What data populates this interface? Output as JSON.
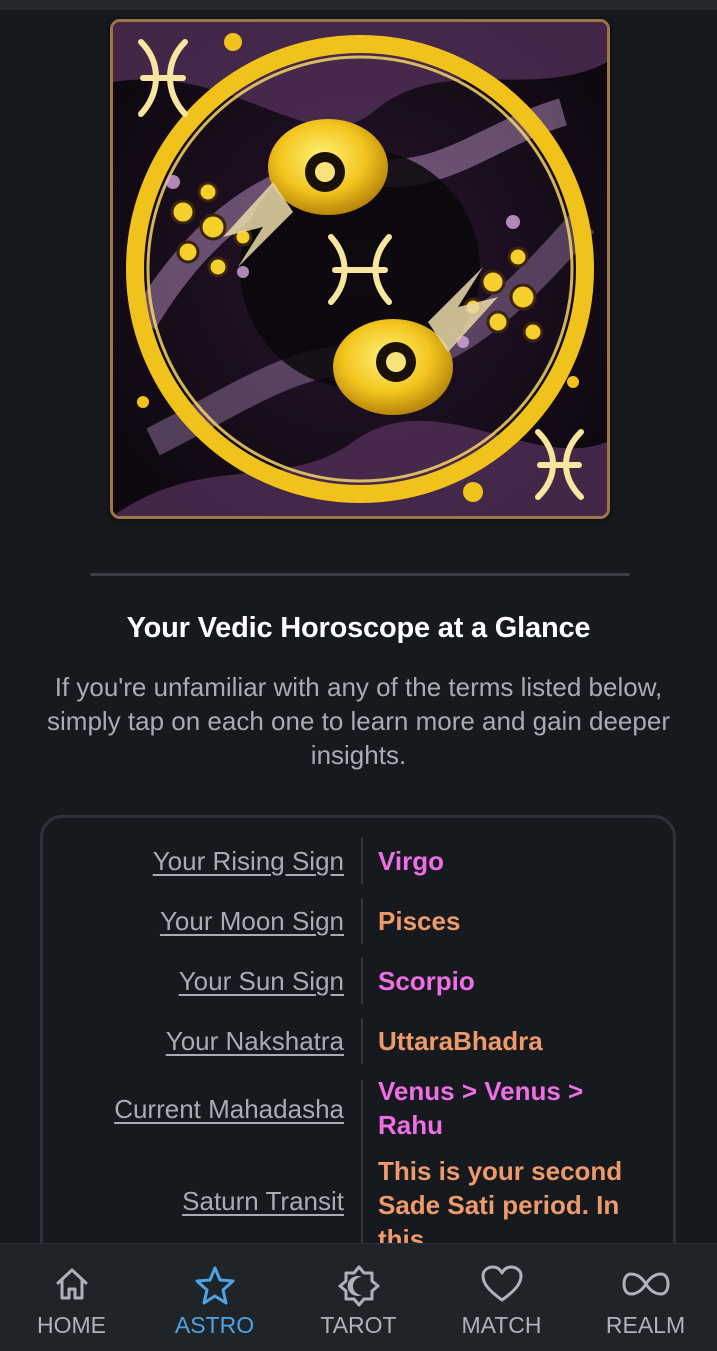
{
  "hero": {
    "image": "pisces-zodiac-artwork",
    "frame_color": "#a0754a"
  },
  "section": {
    "title": "Your Vedic Horoscope at a Glance",
    "subtitle": "If you're unfamiliar with any of the terms listed below, simply tap on each one to learn more and gain deeper insights."
  },
  "horoscope": {
    "rows": [
      {
        "label": "Your Rising Sign",
        "value": "Virgo",
        "color": "#f06ee6"
      },
      {
        "label": "Your Moon Sign",
        "value": "Pisces",
        "color": "#ef9a6a"
      },
      {
        "label": "Your Sun Sign",
        "value": "Scorpio",
        "color": "#f06ee6"
      },
      {
        "label": "Your Nakshatra",
        "value": "UttaraBhadra",
        "color": "#ef9a6a"
      },
      {
        "label": "Current Mahadasha",
        "value": "Venus > Venus > Rahu",
        "color": "#f06ee6"
      },
      {
        "label": "Saturn Transit",
        "value": "This is your second Sade Sati period. In this...",
        "color": "#ef9a6a"
      }
    ]
  },
  "nav": {
    "items": [
      {
        "label": "HOME",
        "icon": "home-icon",
        "active": false
      },
      {
        "label": "ASTRO",
        "icon": "star-icon",
        "active": true
      },
      {
        "label": "TAROT",
        "icon": "sun-moon-icon",
        "active": false
      },
      {
        "label": "MATCH",
        "icon": "heart-icon",
        "active": false
      },
      {
        "label": "REALM",
        "icon": "infinity-icon",
        "active": false
      }
    ],
    "active_color": "#4ea3e6"
  }
}
